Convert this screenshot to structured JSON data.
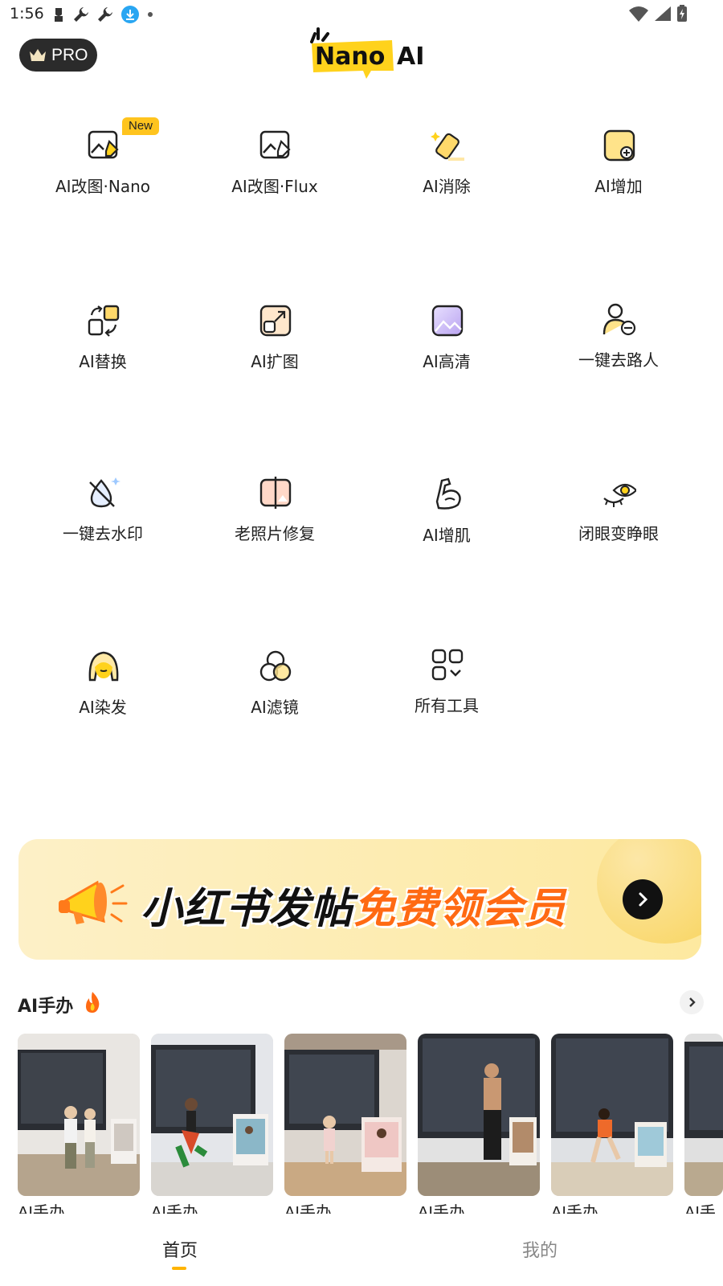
{
  "status_bar": {
    "time": "1:56"
  },
  "header": {
    "pro_label": "PRO",
    "logo_text_main": "Nano",
    "logo_text_suffix": "AI"
  },
  "tools": [
    {
      "label": "AI改图·Nano",
      "badge": "New",
      "icon": "image-edit-icon"
    },
    {
      "label": "AI改图·Flux",
      "icon": "image-edit-icon"
    },
    {
      "label": "AI消除",
      "icon": "eraser-icon"
    },
    {
      "label": "AI增加",
      "icon": "add-image-icon"
    },
    {
      "label": "AI替换",
      "icon": "swap-icon"
    },
    {
      "label": "AI扩图",
      "icon": "expand-icon"
    },
    {
      "label": "AI高清",
      "icon": "hd-image-icon"
    },
    {
      "label": "一键去路人",
      "icon": "remove-person-icon"
    },
    {
      "label": "一键去水印",
      "icon": "remove-watermark-icon"
    },
    {
      "label": "老照片修复",
      "icon": "old-photo-icon"
    },
    {
      "label": "AI增肌",
      "icon": "muscle-icon"
    },
    {
      "label": "闭眼变睁眼",
      "icon": "eye-icon"
    },
    {
      "label": "AI染发",
      "icon": "hair-icon"
    },
    {
      "label": "AI滤镜",
      "icon": "filter-icon"
    },
    {
      "label": "所有工具",
      "icon": "all-tools-icon"
    }
  ],
  "banner": {
    "text_black": "小红书发帖",
    "text_orange": "免费领会员"
  },
  "section": {
    "title": "AI手办",
    "cards": [
      {
        "label": "AI手办"
      },
      {
        "label": "AI手办"
      },
      {
        "label": "AI手办"
      },
      {
        "label": "AI手办"
      },
      {
        "label": "AI手办"
      },
      {
        "label": "AI手"
      }
    ]
  },
  "bottom_nav": {
    "home": "首页",
    "mine": "我的"
  },
  "colors": {
    "accent": "#ffc41e",
    "banner_orange": "#ff6a13",
    "dark": "#2b2b2b"
  }
}
